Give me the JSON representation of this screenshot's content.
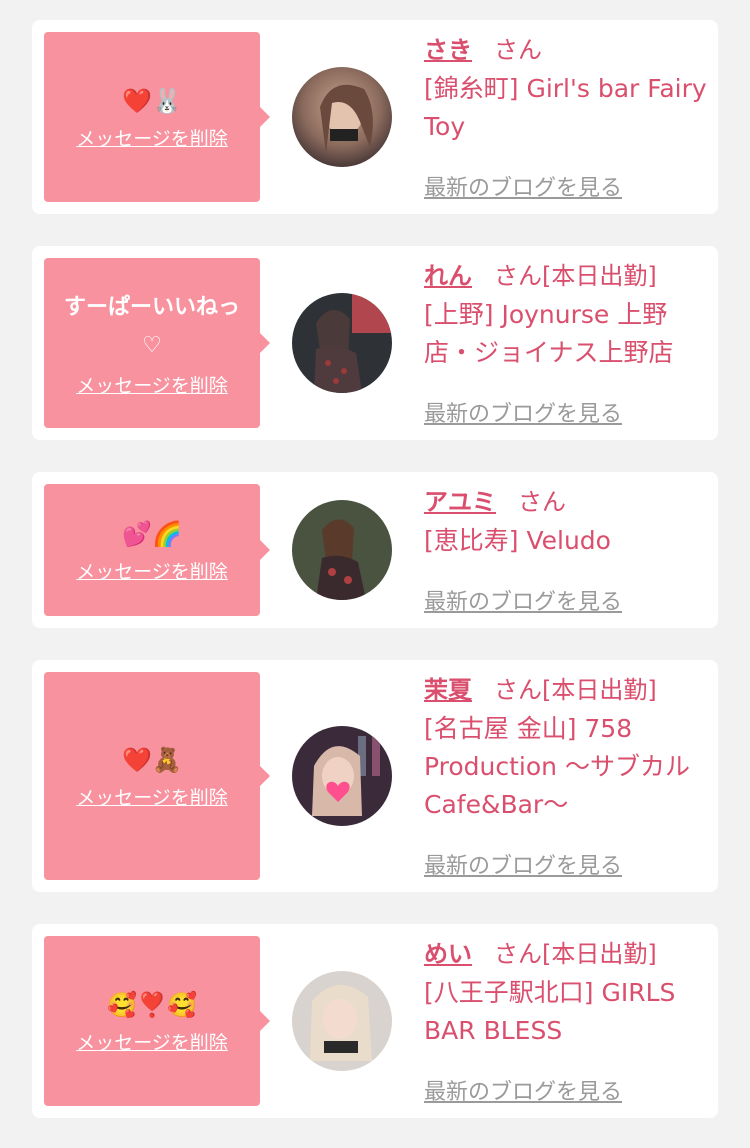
{
  "colors": {
    "background": "#f2f2f2",
    "card": "#ffffff",
    "bubble": "#f8929f",
    "accent": "#d94f6d",
    "muted": "#9a9a9a"
  },
  "cards": [
    {
      "message": "❤️🐰",
      "delete_label": "メッセージを削除",
      "name": "さき",
      "suffix": "さん",
      "shop": "[錦糸町] Girl's bar Fairy Toy",
      "blog_label": "最新のブログを見る",
      "avatar_icon": "profile-photo"
    },
    {
      "message": "すーぱーいいねっ\n♡",
      "delete_label": "メッセージを削除",
      "name": "れん",
      "suffix": "さん[本日出勤]",
      "shop": "[上野] Joynurse 上野店・ジョイナス上野店",
      "blog_label": "最新のブログを見る",
      "avatar_icon": "profile-photo"
    },
    {
      "message": "💕🌈",
      "delete_label": "メッセージを削除",
      "name": "アユミ",
      "suffix": "さん",
      "shop": "[恵比寿] Veludo",
      "blog_label": "最新のブログを見る",
      "avatar_icon": "profile-photo"
    },
    {
      "message": "❤️🧸",
      "delete_label": "メッセージを削除",
      "name": "茉夏",
      "suffix": "さん[本日出勤]",
      "shop": "[名古屋 金山] 758 Production ～サブカルCafe&Bar～",
      "blog_label": "最新のブログを見る",
      "avatar_icon": "profile-photo"
    },
    {
      "message": "🥰❣️🥰",
      "delete_label": "メッセージを削除",
      "name": "めい",
      "suffix": "さん[本日出勤]",
      "shop": "[八王子駅北口] GIRLS BAR BLESS",
      "blog_label": "最新のブログを見る",
      "avatar_icon": "profile-photo"
    }
  ]
}
